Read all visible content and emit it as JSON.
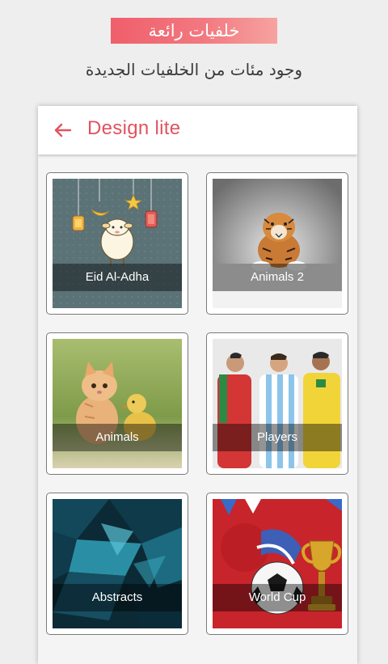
{
  "promo": {
    "badge_text": "خلفيات رائعة",
    "subtitle": "وجود مئات من الخلفيات الجديدة"
  },
  "app_bar": {
    "title": "Design lite",
    "back_icon": "arrow-left-icon"
  },
  "colors": {
    "accent": "#e0535f",
    "card_border": "#7a7a7a",
    "background": "#eeeeee"
  },
  "categories": [
    {
      "label": "Eid Al-Adha",
      "image": "eid-sheep-lanterns"
    },
    {
      "label": "Animals 2",
      "image": "tiger-in-snow"
    },
    {
      "label": "Animals",
      "image": "kitten-and-duckling"
    },
    {
      "label": "Players",
      "image": "three-football-players"
    },
    {
      "label": "Abstracts",
      "image": "teal-polygon-abstract"
    },
    {
      "label": "World Cup",
      "image": "football-and-trophy"
    }
  ]
}
